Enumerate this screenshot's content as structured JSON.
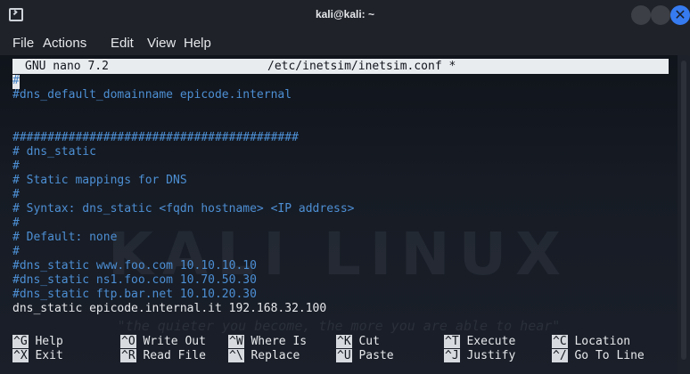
{
  "window": {
    "title": "kali@kali: ~",
    "close_glyph": "✕"
  },
  "menu": {
    "items": [
      "File",
      "Actions",
      "Edit",
      "View",
      "Help"
    ]
  },
  "nano": {
    "version": "GNU nano 7.2",
    "filename": "/etc/inetsim/inetsim.conf *"
  },
  "lines": [
    "#",
    "#dns_default_domainname epicode.internal",
    "",
    "",
    "#########################################",
    "# dns_static",
    "#",
    "# Static mappings for DNS",
    "#",
    "# Syntax: dns_static <fqdn hostname> <IP address>",
    "#",
    "# Default: none",
    "#",
    "#dns_static www.foo.com 10.10.10.10",
    "#dns_static ns1.foo.com 10.70.50.30",
    "#dns_static ftp.bar.net 10.10.20.30",
    "dns_static epicode.internal.it 192.168.32.100"
  ],
  "shortcuts": [
    {
      "key": "^G",
      "label": "Help"
    },
    {
      "key": "^X",
      "label": "Exit"
    },
    {
      "key": "^O",
      "label": "Write Out"
    },
    {
      "key": "^R",
      "label": "Read File"
    },
    {
      "key": "^W",
      "label": "Where Is"
    },
    {
      "key": "^\\",
      "label": "Replace"
    },
    {
      "key": "^K",
      "label": "Cut"
    },
    {
      "key": "^U",
      "label": "Paste"
    },
    {
      "key": "^T",
      "label": "Execute"
    },
    {
      "key": "^J",
      "label": "Justify"
    },
    {
      "key": "^C",
      "label": "Location"
    },
    {
      "key": "^/",
      "label": "Go To Line"
    }
  ],
  "background": {
    "watermark": "KALI LINUX",
    "quote": "\"the quieter you become, the more you are able to hear\""
  },
  "colors": {
    "accent": "#367bf0",
    "comment": "#4d8fd4",
    "text": "#e6e8eb"
  },
  "icons": {
    "app": "terminal-icon",
    "minimize": "minimize-button",
    "maximize": "maximize-button",
    "close": "close-icon"
  }
}
